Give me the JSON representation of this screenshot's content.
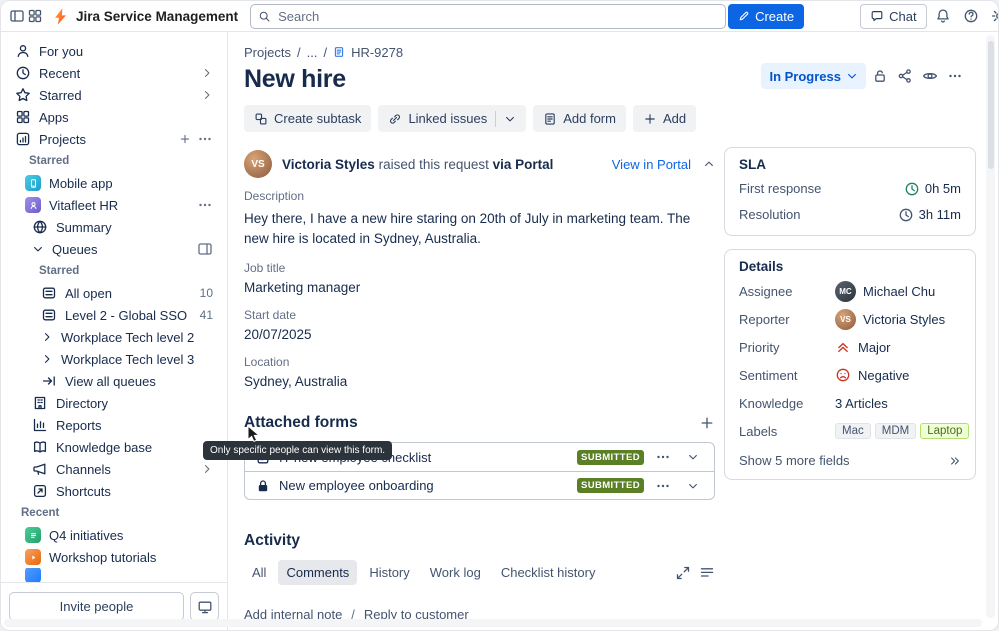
{
  "colors": {
    "accent": "#0C66E4",
    "status-bg": "#E9F2FF",
    "status-text": "#0055CC",
    "submitted-bg": "#5B7F24",
    "danger": "#CA3521",
    "success": "#1F845A",
    "tooltip-bg": "#2C333A",
    "border": "#D5D9E0"
  },
  "topbar": {
    "app_title": "Jira Service Management",
    "search_placeholder": "Search",
    "create_label": "Create",
    "chat_label": "Chat"
  },
  "sidebar": {
    "top": [
      {
        "label": "For you"
      },
      {
        "label": "Recent"
      },
      {
        "label": "Starred"
      },
      {
        "label": "Apps"
      },
      {
        "label": "Projects"
      }
    ],
    "starred_heading": "Starred",
    "starred_apps": [
      {
        "label": "Mobile app"
      },
      {
        "label": "Vitafleet HR"
      }
    ],
    "project_nav": {
      "summary": "Summary",
      "queues": "Queues",
      "queues_group": "Starred",
      "queue_items": [
        {
          "label": "All open",
          "count": "10"
        },
        {
          "label": "Level 2 - Global SSO",
          "count": "41"
        },
        {
          "label": "Workplace Tech level 2"
        },
        {
          "label": "Workplace Tech level 3"
        }
      ],
      "view_all": "View all queues",
      "links": [
        {
          "label": "Directory"
        },
        {
          "label": "Reports"
        },
        {
          "label": "Knowledge base"
        },
        {
          "label": "Channels"
        },
        {
          "label": "Shortcuts"
        }
      ]
    },
    "recent_heading": "Recent",
    "recent_items": [
      {
        "label": "Q4 initiatives"
      },
      {
        "label": "Workshop tutorials"
      }
    ],
    "invite_label": "Invite people"
  },
  "issue": {
    "breadcrumb": {
      "root": "Projects",
      "sep": "/",
      "ellipsis": "...",
      "key": "HR-9278"
    },
    "title": "New hire",
    "status": "In Progress",
    "toolbar": {
      "create_subtask": "Create subtask",
      "linked_issues": "Linked issues",
      "add_form": "Add form",
      "add": "Add"
    },
    "request": {
      "reporter": "Victoria Styles",
      "initials": "VS",
      "text": "raised this request",
      "via": "via Portal",
      "view_in_portal": "View in Portal"
    },
    "description_label": "Description",
    "description": "Hey there, I have a new hire staring on 20th of July in marketing team. The new hire is located in Sydney, Australia.",
    "fields": [
      {
        "label": "Job title",
        "value": "Marketing manager"
      },
      {
        "label": "Start date",
        "value": "20/07/2025"
      },
      {
        "label": "Location",
        "value": "Sydney, Australia"
      }
    ],
    "forms": {
      "heading": "Attached forms",
      "items": [
        {
          "name": "IT new employee checklist",
          "status": "SUBMITTED"
        },
        {
          "name": "New employee onboarding",
          "status": "SUBMITTED"
        }
      ],
      "tooltip": "Only specific people can view this form."
    },
    "activity": {
      "heading": "Activity",
      "tabs": [
        {
          "label": "All"
        },
        {
          "label": "Comments"
        },
        {
          "label": "History"
        },
        {
          "label": "Work log"
        },
        {
          "label": "Checklist history"
        }
      ],
      "selected_tab": "Comments",
      "internal_note": "Add internal note",
      "separator": "/",
      "reply": "Reply to customer"
    }
  },
  "panels": {
    "sla": {
      "heading": "SLA",
      "rows": [
        {
          "label": "First response",
          "value": "0h 5m"
        },
        {
          "label": "Resolution",
          "value": "3h 11m"
        }
      ]
    },
    "details": {
      "heading": "Details",
      "assignee": {
        "label": "Assignee",
        "value": "Michael Chu",
        "initials": "MC"
      },
      "reporter": {
        "label": "Reporter",
        "value": "Victoria Styles",
        "initials": "VS"
      },
      "priority": {
        "label": "Priority",
        "value": "Major"
      },
      "sentiment": {
        "label": "Sentiment",
        "value": "Negative"
      },
      "knowledge": {
        "label": "Knowledge",
        "value": "3 Articles"
      },
      "labels": {
        "label": "Labels",
        "tags": [
          "Mac",
          "MDM",
          "Laptop"
        ]
      },
      "show_more": "Show 5 more fields"
    }
  }
}
